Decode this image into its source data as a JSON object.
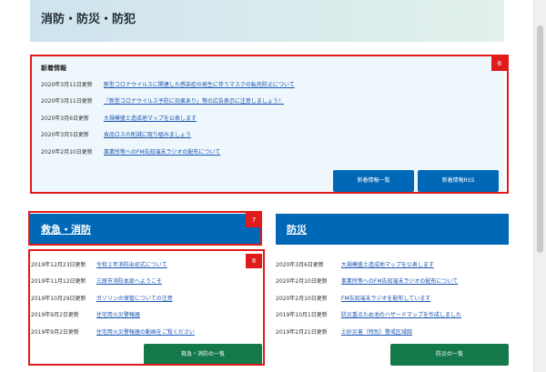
{
  "page_title": "消防・防災・防犯",
  "news": {
    "heading": "新着情報",
    "badge": "6",
    "items": [
      {
        "date": "2020年3月11日更新",
        "text": "新型コロナウイルスに関連した感染症の発生に伴うマスクの転売防止について"
      },
      {
        "date": "2020年3月11日更新",
        "text": "「新型コロナウイルス予防に効果あり」等の広告表示に注意しましょう！"
      },
      {
        "date": "2020年3月6日更新",
        "text": "大規模盛土造成地マップを公表します"
      },
      {
        "date": "2020年3月5日更新",
        "text": "食品ロスの削減に取り組みましょう"
      },
      {
        "date": "2020年2月10日更新",
        "text": "事業所等へのFM告知端末ラジオの配布について"
      }
    ],
    "btn_list": "新着情報一覧",
    "btn_rss": "新着情報RSS"
  },
  "kyukyu": {
    "heading": "救急・消防",
    "badge_heading": "7",
    "badge_list": "8",
    "items": [
      {
        "date": "2019年12月23日更新",
        "text": "令和２年消防出初式について"
      },
      {
        "date": "2019年11月12日更新",
        "text": "三原市消防本部へようこそ"
      },
      {
        "date": "2019年10月29日更新",
        "text": "ガソリンの保管についての注意"
      },
      {
        "date": "2019年9月2日更新",
        "text": "住宅用火災警報器"
      },
      {
        "date": "2019年9月2日更新",
        "text": "住宅用火災警報器の動画をご覧ください"
      }
    ],
    "more": "救急・消防の一覧"
  },
  "bousai": {
    "heading": "防災",
    "items": [
      {
        "date": "2020年3月6日更新",
        "text": "大規模盛土造成地マップを公表します"
      },
      {
        "date": "2020年2月10日更新",
        "text": "事業所等へのFM告知端末ラジオの配布について"
      },
      {
        "date": "2020年2月10日更新",
        "text": "FM告知端末ラジオを配布しています"
      },
      {
        "date": "2019年10月1日更新",
        "text": "防災重点ため池のハザードマップを作成しました"
      },
      {
        "date": "2019年2月21日更新",
        "text": "土砂災害（特別）警戒区域図"
      }
    ],
    "more": "防災の一覧"
  }
}
